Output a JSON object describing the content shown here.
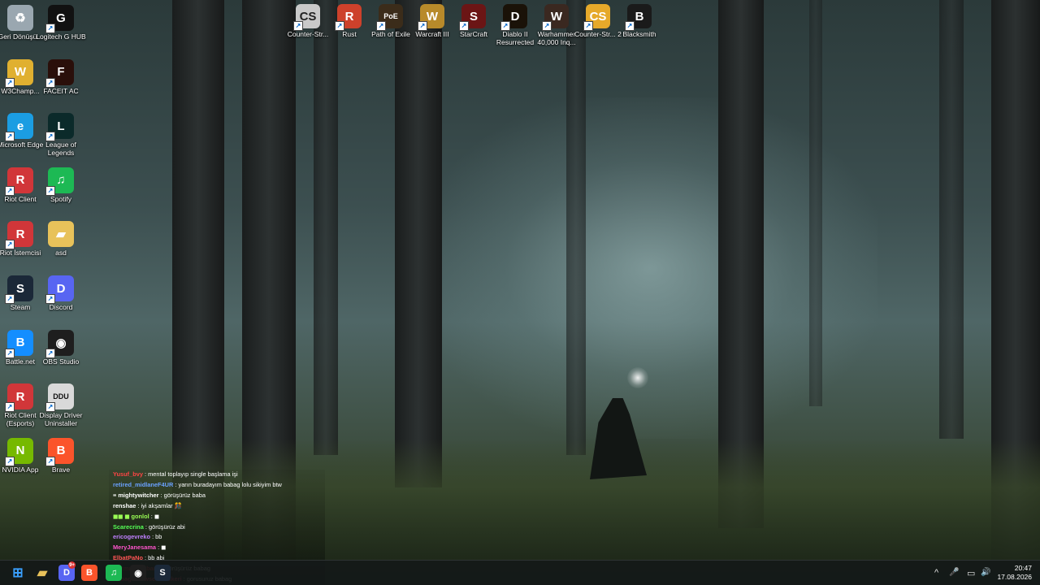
{
  "left_icons": [
    {
      "name": "recycle-bin-icon",
      "label": "Geri Dönüşü...",
      "glyph": "♻",
      "bg": "#9aa7b0"
    },
    {
      "name": "logitech-g-hub-icon",
      "label": "Logitech G HUB",
      "glyph": "G",
      "bg": "#111111"
    },
    {
      "name": "w3champions-icon",
      "label": "W3Champ...",
      "glyph": "W",
      "bg": "#e0b030"
    },
    {
      "name": "faceit-ac-icon",
      "label": "FACEIT AC",
      "glyph": "F",
      "bg": "#2a0f0a"
    },
    {
      "name": "microsoft-edge-icon",
      "label": "Microsoft Edge",
      "glyph": "e",
      "bg": "#1b9de2"
    },
    {
      "name": "league-of-legends-icon",
      "label": "League of Legends",
      "glyph": "L",
      "bg": "#0b2a2a"
    },
    {
      "name": "riot-client-icon",
      "label": "Riot Client",
      "glyph": "R",
      "bg": "#d13639"
    },
    {
      "name": "spotify-icon",
      "label": "Spotify",
      "glyph": "♫",
      "bg": "#1db954"
    },
    {
      "name": "riot-istemcisi-icon",
      "label": "Riot İstemcisi",
      "glyph": "R",
      "bg": "#d13639"
    },
    {
      "name": "asd-folder-icon",
      "label": "asd",
      "glyph": "▰",
      "bg": "#e8c25a"
    },
    {
      "name": "steam-icon",
      "label": "Steam",
      "glyph": "S",
      "bg": "#1b2838"
    },
    {
      "name": "discord-icon",
      "label": "Discord",
      "glyph": "D",
      "bg": "#5865f2"
    },
    {
      "name": "battle-net-icon",
      "label": "Battle.net",
      "glyph": "B",
      "bg": "#148eff"
    },
    {
      "name": "obs-studio-icon",
      "label": "OBS Studio",
      "glyph": "◉",
      "bg": "#1e1e1e"
    },
    {
      "name": "riot-client-esports-icon",
      "label": "Riot Client (Esports)",
      "glyph": "R",
      "bg": "#d13639"
    },
    {
      "name": "display-driver-uninstaller-icon",
      "label": "Display Driver Uninstaller",
      "glyph": "DDU",
      "bg": "#d9d9d9"
    },
    {
      "name": "nvidia-app-icon",
      "label": "NVIDIA App",
      "glyph": "N",
      "bg": "#76b900"
    },
    {
      "name": "brave-icon",
      "label": "Brave",
      "glyph": "B",
      "bg": "#fb542b"
    }
  ],
  "top_icons": [
    {
      "name": "counter-strike-icon",
      "label": "Counter-Str...",
      "glyph": "CS",
      "bg": "#c9c9c9"
    },
    {
      "name": "rust-icon",
      "label": "Rust",
      "glyph": "R",
      "bg": "#cd412b"
    },
    {
      "name": "path-of-exile-icon",
      "label": "Path of Exile",
      "glyph": "PoE",
      "bg": "#3b2c1a"
    },
    {
      "name": "warcraft-3-icon",
      "label": "Warcraft III",
      "glyph": "W",
      "bg": "#b88a2a"
    },
    {
      "name": "starcraft-icon",
      "label": "StarCraft",
      "glyph": "S",
      "bg": "#6b1515"
    },
    {
      "name": "diablo-2-icon",
      "label": "Diablo II Resurrected",
      "glyph": "D",
      "bg": "#1a1208"
    },
    {
      "name": "warhammer-icon",
      "label": "Warhammer 40,000 Inq...",
      "glyph": "W",
      "bg": "#3a2820"
    },
    {
      "name": "counter-strike-2-icon",
      "label": "Counter-Str... 2",
      "glyph": "CS",
      "bg": "#e6a92a"
    },
    {
      "name": "blacksmith-icon",
      "label": "Blacksmith",
      "glyph": "B",
      "bg": "#1a1a1a"
    }
  ],
  "chat": [
    {
      "user": "Yusuf_bvy",
      "color": "#ff4444",
      "text": " : mental toplayıp single başlama işi"
    },
    {
      "user": "retired_midlaneF4UR",
      "color": "#6aa0ff",
      "text": " : yarın buradayım babag lolu sikiyim btw"
    },
    {
      "user": "≡  mightywitcher",
      "color": "#ffffff",
      "text": " : görüşürüz baba"
    },
    {
      "user": "renshae",
      "color": "#ffffff",
      "text": " : iyi akşamlar 🎊"
    },
    {
      "user": "◼◼ ◼ gonlol",
      "color": "#9aff55",
      "text": " : ◼"
    },
    {
      "user": "Scarecrina",
      "color": "#55ff55",
      "text": " : görüşürüz abi"
    },
    {
      "user": "ericogevreko",
      "color": "#c080ff",
      "text": " : bb"
    },
    {
      "user": "MeryJanesama",
      "color": "#ff55cc",
      "text": " : ◼"
    },
    {
      "user": "ElbatPaNo",
      "color": "#ff5555",
      "text": " : bb abi"
    },
    {
      "user": "Durmuz_Babane",
      "color": "#ff4444",
      "text": " : görüşürüz babag"
    },
    {
      "user": "Babagimrewscholaskeri",
      "color": "#ff4466",
      "text": " : gorusuruz babag"
    }
  ],
  "taskbar": {
    "apps": [
      {
        "name": "start-icon",
        "glyph": "⊞",
        "bg": "transparent",
        "color": "#3aa0ff"
      },
      {
        "name": "file-explorer-icon",
        "glyph": "▰",
        "bg": "transparent",
        "color": "#e8c25a"
      },
      {
        "name": "discord-taskbar-icon",
        "glyph": "D",
        "bg": "#5865f2",
        "color": "#ffffff"
      },
      {
        "name": "brave-taskbar-icon",
        "glyph": "B",
        "bg": "#fb542b",
        "color": "#ffffff"
      },
      {
        "name": "spotify-taskbar-icon",
        "glyph": "♫",
        "bg": "#1db954",
        "color": "#ffffff"
      },
      {
        "name": "obs-taskbar-icon",
        "glyph": "◉",
        "bg": "#1e1e1e",
        "color": "#ffffff"
      },
      {
        "name": "steam-taskbar-icon",
        "glyph": "S",
        "bg": "#1b2838",
        "color": "#ffffff"
      }
    ],
    "discord_badge": "9+",
    "tray": {
      "chevron": "^",
      "mic": "🎤",
      "network": "▭",
      "volume": "🔊"
    },
    "time": "20:47",
    "date": "17.08.2026"
  }
}
